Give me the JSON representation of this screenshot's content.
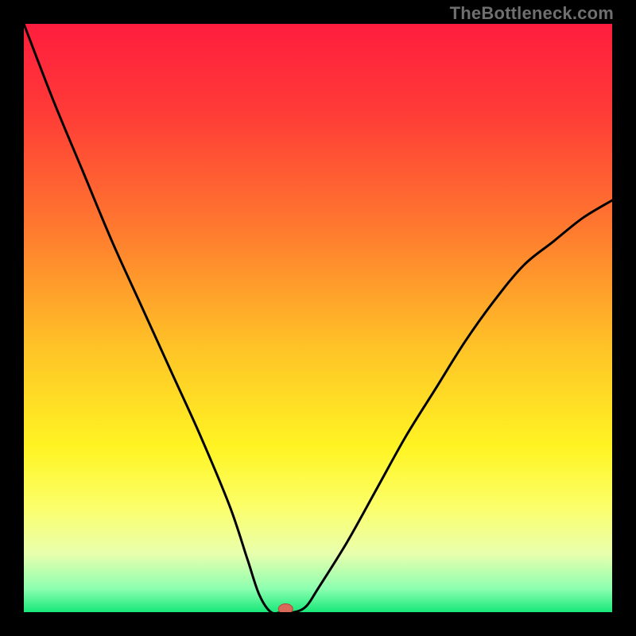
{
  "watermark": {
    "text": "TheBottleneck.com"
  },
  "chart_data": {
    "type": "line",
    "title": "",
    "xlabel": "",
    "ylabel": "",
    "xlim": [
      0,
      100
    ],
    "ylim": [
      0,
      100
    ],
    "grid": false,
    "legend": false,
    "series": [
      {
        "name": "bottleneck-curve",
        "x": [
          0,
          5,
          10,
          15,
          20,
          25,
          30,
          35,
          38,
          40,
          42,
          44,
          46,
          48,
          50,
          55,
          60,
          65,
          70,
          75,
          80,
          85,
          90,
          95,
          100
        ],
        "y": [
          100,
          87,
          75,
          63,
          52,
          41,
          30,
          18,
          9,
          3,
          0,
          0,
          0,
          1,
          4,
          12,
          21,
          30,
          38,
          46,
          53,
          59,
          63,
          67,
          70
        ]
      }
    ],
    "background_gradient": {
      "stops": [
        {
          "offset": 0.0,
          "color": "#ff1d3e"
        },
        {
          "offset": 0.15,
          "color": "#ff3b37"
        },
        {
          "offset": 0.35,
          "color": "#ff7a2f"
        },
        {
          "offset": 0.55,
          "color": "#ffc327"
        },
        {
          "offset": 0.72,
          "color": "#fff423"
        },
        {
          "offset": 0.82,
          "color": "#fcff69"
        },
        {
          "offset": 0.9,
          "color": "#e9ffad"
        },
        {
          "offset": 0.96,
          "color": "#8dffb0"
        },
        {
          "offset": 1.0,
          "color": "#17e879"
        }
      ]
    },
    "marker": {
      "x": 44.5,
      "y": 0,
      "color": "#d96a5a"
    },
    "annotations": [
      {
        "text": "TheBottleneck.com",
        "position": "top-right"
      }
    ]
  }
}
